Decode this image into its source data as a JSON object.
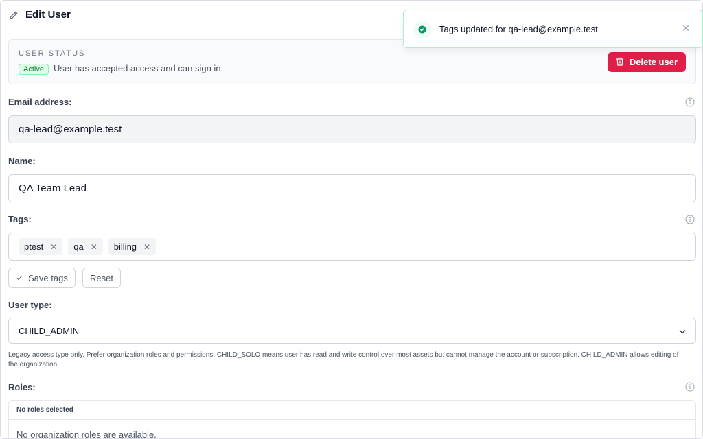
{
  "header": {
    "title": "Edit User",
    "icon": "pencil-icon"
  },
  "status": {
    "section_label": "USER STATUS",
    "badge": "Active",
    "text": "User has accepted access and can sign in.",
    "delete_label": "Delete user",
    "accent": "#e11d48"
  },
  "email": {
    "label": "Email address:",
    "value": "qa-lead@example.test"
  },
  "name": {
    "label": "Name:",
    "value": "QA Team Lead"
  },
  "tags": {
    "label": "Tags:",
    "items": [
      "ptest",
      "qa",
      "billing"
    ],
    "save_label": "Save tags",
    "reset_label": "Reset"
  },
  "user_type": {
    "label": "User type:",
    "value": "CHILD_ADMIN",
    "help": "Legacy access type only. Prefer organization roles and permissions. CHILD_SOLO means user has read and write control over most assets but cannot manage the account or subscription. CHILD_ADMIN allows editing of the organization."
  },
  "roles": {
    "label": "Roles:",
    "header": "No roles selected",
    "empty": "No organization roles are available."
  },
  "toast": {
    "message": "Tags updated for qa-lead@example.test",
    "color": "#10b981"
  }
}
